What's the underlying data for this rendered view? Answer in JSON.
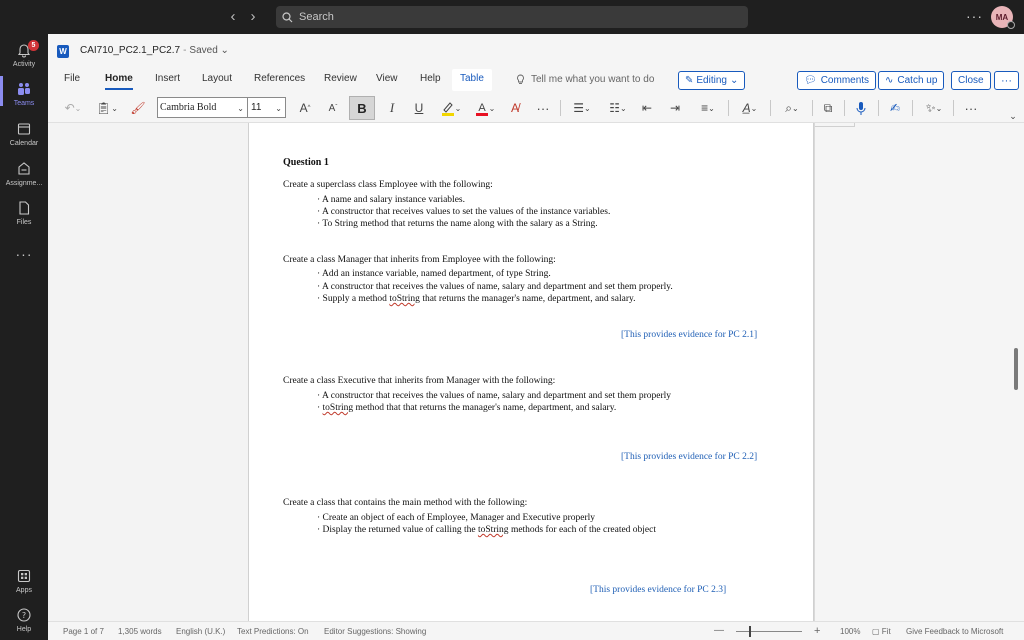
{
  "topbar": {
    "search_placeholder": "Search",
    "more": "···",
    "avatar_initials": "MA"
  },
  "rail": {
    "activity": {
      "label": "Activity",
      "badge": "5"
    },
    "teams": {
      "label": "Teams"
    },
    "calendar": {
      "label": "Calendar"
    },
    "assignments": {
      "label": "Assignme..."
    },
    "files": {
      "label": "Files"
    },
    "more": "···",
    "apps": {
      "label": "Apps"
    },
    "help": {
      "label": "Help"
    }
  },
  "document": {
    "title": "CAI710_PC2.1_PC2.7",
    "separator": "-",
    "status": "Saved"
  },
  "ribbon": {
    "tabs": [
      "File",
      "Home",
      "Insert",
      "Layout",
      "References",
      "Review",
      "View",
      "Help"
    ],
    "active_tab": "Home",
    "contextual_tab": "Table",
    "tell_me": "Tell me what you want to do",
    "editing": "Editing",
    "comments": "Comments",
    "catch_up": "Catch up",
    "close": "Close",
    "more": "···"
  },
  "toolbar": {
    "font_name": "Cambria Bold",
    "font_size": "11",
    "bold": "B",
    "italic": "I",
    "underline": "U",
    "more": "···"
  },
  "content": {
    "question_title": "Question 1",
    "section1": {
      "intro": "Create a superclass class Employee with the following:",
      "bullets": [
        "A name and salary instance variables.",
        "A constructor that receives values to set the values of the instance variables.",
        "To String method that returns the name along with the salary as a String."
      ]
    },
    "section2": {
      "intro": "Create a class Manager that inherits from Employee with the following:",
      "bullet1": "Add an instance variable, named department, of type String.",
      "bullet2": "A constructor that receives the values of name, salary and department and set them properly.",
      "bullet3_pre": "Supply a method ",
      "bullet3_word": "toString",
      "bullet3_post": " that returns the manager's name, department, and salary.",
      "evidence": "[This provides evidence for PC 2.1]"
    },
    "section3": {
      "intro": "Create a class Executive that inherits from Manager with the following:",
      "bullet1": "A constructor that receives the values of name, salary and department and set them properly",
      "bullet2_word": "toString",
      "bullet2_post": " method that that returns the manager's name, department, and salary.",
      "evidence": "[This provides evidence for PC 2.2]"
    },
    "section4": {
      "intro": "Create a class that contains the main method with the following:",
      "bullet1": "Create an object of each of Employee, Manager and Executive properly",
      "bullet2_pre": "Display the returned value of calling the ",
      "bullet2_word": "toString",
      "bullet2_post": " methods for each of the created object",
      "evidence": "[This provides evidence for PC 2.3]"
    }
  },
  "statusbar": {
    "page": "Page 1 of 7",
    "words": "1,305 words",
    "language": "English (U.K.)",
    "text_predictions": "Text Predictions: On",
    "editor_suggestions": "Editor Suggestions: Showing",
    "zoom_minus": "—",
    "zoom_plus": "+",
    "zoom_level": "100%",
    "fit": "Fit",
    "feedback": "Give Feedback to Microsoft"
  },
  "colors": {
    "accent": "#185abd",
    "teams_purple": "#8b8cf0",
    "evidence_blue": "#1f5fb5",
    "badge_red": "#d13438"
  }
}
